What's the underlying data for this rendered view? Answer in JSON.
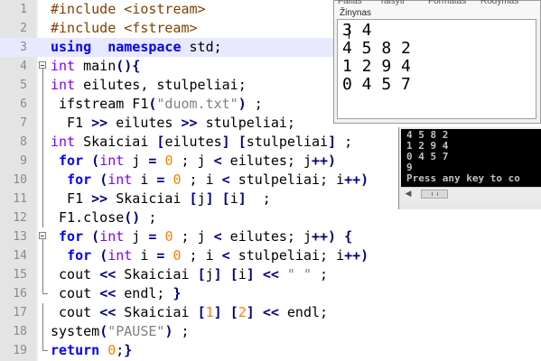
{
  "editor": {
    "lines": [
      {
        "num": "1",
        "segs": [
          [
            "pp",
            "#include <iostream>"
          ]
        ]
      },
      {
        "num": "2",
        "segs": [
          [
            "pp",
            "#include <fstream>"
          ]
        ]
      },
      {
        "num": "3",
        "segs": [
          [
            "kw",
            "using"
          ],
          [
            "",
            "  "
          ],
          [
            "kw",
            "namespace"
          ],
          [
            "",
            " std;"
          ]
        ]
      },
      {
        "num": "4",
        "segs": [
          [
            "ty",
            "int"
          ],
          [
            "",
            " main"
          ],
          [
            "op",
            "(){"
          ]
        ]
      },
      {
        "num": "5",
        "segs": [
          [
            "ty",
            "int"
          ],
          [
            "",
            " eilutes, stulpeliai;"
          ]
        ]
      },
      {
        "num": "6",
        "segs": [
          [
            "",
            " ifstream F1"
          ],
          [
            "op",
            "("
          ],
          [
            "str",
            "\"duom.txt\""
          ],
          [
            "op",
            ")"
          ],
          [
            "",
            " ;"
          ]
        ]
      },
      {
        "num": "7",
        "segs": [
          [
            "",
            "  F1 "
          ],
          [
            "op",
            ">>"
          ],
          [
            "",
            " eilutes "
          ],
          [
            "op",
            ">>"
          ],
          [
            "",
            " stulpeliai;"
          ]
        ]
      },
      {
        "num": "8",
        "segs": [
          [
            "ty",
            "int"
          ],
          [
            "",
            " Skaiciai "
          ],
          [
            "op",
            "["
          ],
          [
            "",
            "eilutes"
          ],
          [
            "op",
            "]"
          ],
          [
            "",
            " "
          ],
          [
            "op",
            "["
          ],
          [
            "",
            "stulpeliai"
          ],
          [
            "op",
            "]"
          ],
          [
            "",
            " ;"
          ]
        ]
      },
      {
        "num": "9",
        "segs": [
          [
            "",
            " "
          ],
          [
            "kw",
            "for"
          ],
          [
            "",
            " "
          ],
          [
            "op",
            "("
          ],
          [
            "ty",
            "int"
          ],
          [
            "",
            " j "
          ],
          [
            "op",
            "="
          ],
          [
            "",
            " "
          ],
          [
            "num",
            "0"
          ],
          [
            "",
            " ; j "
          ],
          [
            "op",
            "<"
          ],
          [
            "",
            " eilutes; j"
          ],
          [
            "op",
            "++)"
          ]
        ]
      },
      {
        "num": "10",
        "segs": [
          [
            "",
            "  "
          ],
          [
            "kw",
            "for"
          ],
          [
            "",
            " "
          ],
          [
            "op",
            "("
          ],
          [
            "ty",
            "int"
          ],
          [
            "",
            " i "
          ],
          [
            "op",
            "="
          ],
          [
            "",
            " "
          ],
          [
            "num",
            "0"
          ],
          [
            "",
            " ; i "
          ],
          [
            "op",
            "<"
          ],
          [
            "",
            " stulpeliai; i"
          ],
          [
            "op",
            "++)"
          ]
        ]
      },
      {
        "num": "11",
        "segs": [
          [
            "",
            "  F1 "
          ],
          [
            "op",
            ">>"
          ],
          [
            "",
            " Skaiciai "
          ],
          [
            "op",
            "["
          ],
          [
            "",
            "j"
          ],
          [
            "op",
            "]"
          ],
          [
            "",
            " "
          ],
          [
            "op",
            "["
          ],
          [
            "",
            "i"
          ],
          [
            "op",
            "]"
          ],
          [
            "",
            "  ;"
          ]
        ]
      },
      {
        "num": "12",
        "segs": [
          [
            "",
            " F1.close"
          ],
          [
            "op",
            "()"
          ],
          [
            "",
            " ;"
          ]
        ]
      },
      {
        "num": "13",
        "segs": [
          [
            "",
            " "
          ],
          [
            "kw",
            "for"
          ],
          [
            "",
            " "
          ],
          [
            "op",
            "("
          ],
          [
            "ty",
            "int"
          ],
          [
            "",
            " j "
          ],
          [
            "op",
            "="
          ],
          [
            "",
            " "
          ],
          [
            "num",
            "0"
          ],
          [
            "",
            " ; j "
          ],
          [
            "op",
            "<"
          ],
          [
            "",
            " eilutes; j"
          ],
          [
            "op",
            "++)"
          ],
          [
            "",
            " "
          ],
          [
            "op",
            "{"
          ]
        ]
      },
      {
        "num": "14",
        "segs": [
          [
            "",
            "  "
          ],
          [
            "kw",
            "for"
          ],
          [
            "",
            " "
          ],
          [
            "op",
            "("
          ],
          [
            "ty",
            "int"
          ],
          [
            "",
            " i "
          ],
          [
            "op",
            "="
          ],
          [
            "",
            " "
          ],
          [
            "num",
            "0"
          ],
          [
            "",
            " ; i "
          ],
          [
            "op",
            "<"
          ],
          [
            "",
            " stulpeliai; i"
          ],
          [
            "op",
            "++)"
          ]
        ]
      },
      {
        "num": "15",
        "segs": [
          [
            "",
            " cout "
          ],
          [
            "op",
            "<<"
          ],
          [
            "",
            " Skaiciai "
          ],
          [
            "op",
            "["
          ],
          [
            "",
            "j"
          ],
          [
            "op",
            "]"
          ],
          [
            "",
            " "
          ],
          [
            "op",
            "["
          ],
          [
            "",
            "i"
          ],
          [
            "op",
            "]"
          ],
          [
            "",
            " "
          ],
          [
            "op",
            "<<"
          ],
          [
            "",
            " "
          ],
          [
            "str",
            "\" \""
          ],
          [
            "",
            " ;"
          ]
        ]
      },
      {
        "num": "16",
        "segs": [
          [
            "",
            " cout "
          ],
          [
            "op",
            "<<"
          ],
          [
            "",
            " endl; "
          ],
          [
            "op",
            "}"
          ]
        ]
      },
      {
        "num": "17",
        "segs": [
          [
            "",
            " cout "
          ],
          [
            "op",
            "<<"
          ],
          [
            "",
            " Skaiciai "
          ],
          [
            "op",
            "["
          ],
          [
            "num",
            "1"
          ],
          [
            "op",
            "]"
          ],
          [
            "",
            " "
          ],
          [
            "op",
            "["
          ],
          [
            "num",
            "2"
          ],
          [
            "op",
            "]"
          ],
          [
            "",
            " "
          ],
          [
            "op",
            "<<"
          ],
          [
            "",
            " endl;"
          ]
        ]
      },
      {
        "num": "18",
        "segs": [
          [
            "",
            "system"
          ],
          [
            "op",
            "("
          ],
          [
            "str",
            "\"PAUSE\""
          ],
          [
            "op",
            ")"
          ],
          [
            "",
            " ;"
          ]
        ]
      },
      {
        "num": "19",
        "segs": [
          [
            "kw",
            "return"
          ],
          [
            "",
            " "
          ],
          [
            "num",
            "0"
          ],
          [
            "",
            ";"
          ],
          [
            "op",
            "}"
          ]
        ]
      }
    ]
  },
  "output_window": {
    "menu_top": [
      "Failas",
      "Taisyti",
      "Formatas",
      "Rodymas"
    ],
    "menu_help": "Žinynas",
    "lines": [
      "3 4",
      "4 5 8 2",
      "1 2 9 4",
      "0 4 5 7"
    ]
  },
  "console": {
    "lines": [
      "4 5 8 2",
      "1 2 9 4",
      "0 4 5 7",
      "9",
      "Press any key to co"
    ]
  }
}
